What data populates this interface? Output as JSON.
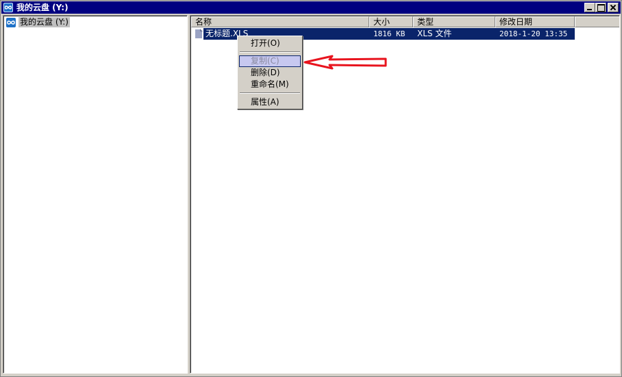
{
  "window": {
    "title": "我的云盘 (Y:)",
    "icon": "cloud-drive-icon",
    "caption_buttons": [
      "minimize",
      "maximize",
      "close"
    ]
  },
  "tree": {
    "items": [
      {
        "label": "我的云盘 (Y:)",
        "icon": "cloud-drive-icon",
        "selected": true
      }
    ]
  },
  "list": {
    "columns": [
      "名称",
      "大小",
      "类型",
      "修改日期"
    ],
    "rows": [
      {
        "name": "无标题.XLS",
        "size": "1816 KB",
        "type": "XLS 文件",
        "modified": "2018-1-20 13:35",
        "selected": true,
        "icon": "file-icon"
      }
    ]
  },
  "context_menu": {
    "items": [
      {
        "label": "打开(O)"
      },
      {
        "label": "复制(C)",
        "highlighted": true
      },
      {
        "label": "删除(D)"
      },
      {
        "label": "重命名(M)"
      },
      {
        "label": "属性(A)"
      }
    ]
  },
  "colors": {
    "title_bar": "#000080",
    "selection": "#0a246a",
    "face": "#d4d0c8",
    "annotation_arrow": "#e8141e"
  }
}
